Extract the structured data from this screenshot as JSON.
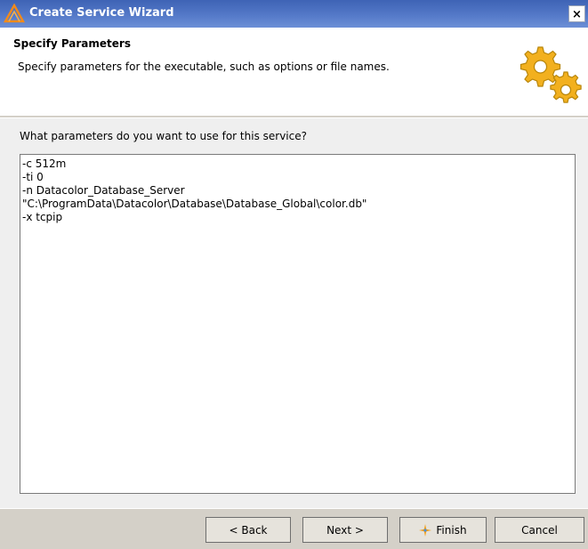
{
  "window": {
    "title": "Create Service Wizard",
    "close_glyph": "×"
  },
  "header": {
    "title": "Specify Parameters",
    "subtitle": "Specify parameters for the executable, such as options or file names.",
    "icon": "gears-icon"
  },
  "body": {
    "question": "What parameters do you want to use for this service?",
    "parameters_value": "-c 512m\n-ti 0\n-n Datacolor_Database_Server\n\"C:\\ProgramData\\Datacolor\\Database\\Database_Global\\color.db\"\n-x tcpip\n"
  },
  "footer": {
    "back_label": "< Back",
    "next_label": "Next >",
    "finish_label": "Finish",
    "cancel_label": "Cancel",
    "finish_icon": "sparkle-icon"
  },
  "colors": {
    "titlebar": "#4a6fc0",
    "footer": "#d4d0c8",
    "body_bg": "#efefef",
    "gear": "#f2b01e"
  }
}
